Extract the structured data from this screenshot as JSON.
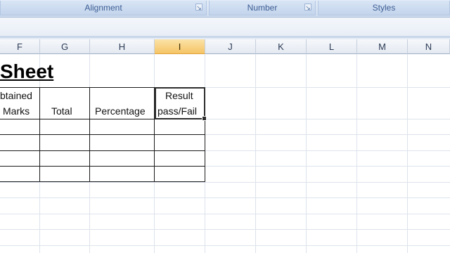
{
  "ribbon": {
    "groups": [
      {
        "label": "Alignment"
      },
      {
        "label": "Number"
      },
      {
        "label": "Styles"
      }
    ]
  },
  "columns": [
    "F",
    "G",
    "H",
    "I",
    "J",
    "K",
    "L",
    "M",
    "N"
  ],
  "selected_column": "I",
  "sheet": {
    "title": "Sheet",
    "headers": {
      "obtained_line1": "btained",
      "obtained_line2": "Marks",
      "total": "Total",
      "percentage": "Percentage",
      "result_line1": "Result",
      "result_line2": "pass/Fail"
    }
  }
}
